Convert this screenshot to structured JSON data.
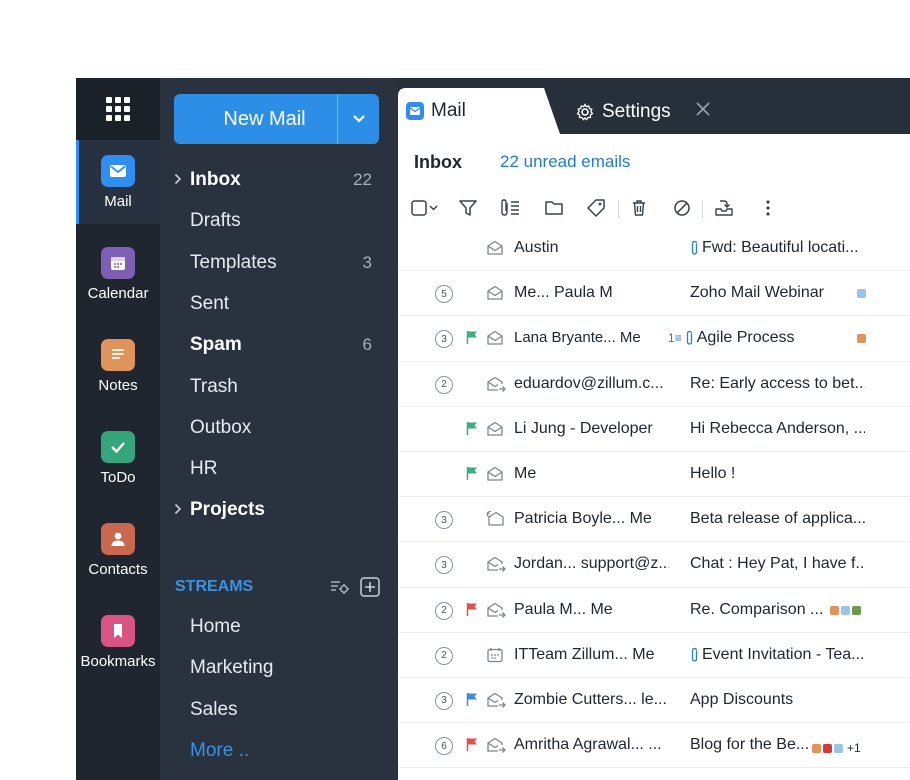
{
  "rail": {
    "items": [
      {
        "label": "Mail",
        "icon": "mail-icon",
        "color": "#2f8ef0",
        "active": true
      },
      {
        "label": "Calendar",
        "icon": "calendar-icon",
        "color": "#7e5fb5"
      },
      {
        "label": "Notes",
        "icon": "notes-icon",
        "color": "#e0935a"
      },
      {
        "label": "ToDo",
        "icon": "todo-icon",
        "color": "#35a57c"
      },
      {
        "label": "Contacts",
        "icon": "contacts-icon",
        "color": "#c8684f"
      },
      {
        "label": "Bookmarks",
        "icon": "bookmarks-icon",
        "color": "#d95482"
      }
    ]
  },
  "folders": {
    "new_mail_label": "New Mail",
    "items": [
      {
        "label": "Inbox",
        "count": "22",
        "bold": true,
        "expandable": true
      },
      {
        "label": "Drafts",
        "count": ""
      },
      {
        "label": "Templates",
        "count": "3"
      },
      {
        "label": "Sent",
        "count": ""
      },
      {
        "label": "Spam",
        "count": "6",
        "bold": true
      },
      {
        "label": "Trash",
        "count": ""
      },
      {
        "label": "Outbox",
        "count": ""
      },
      {
        "label": "HR",
        "count": ""
      },
      {
        "label": "Projects",
        "count": "",
        "bold": true,
        "expandable": true
      }
    ],
    "streams_title": "STREAMS",
    "streams": [
      "Home",
      "Marketing",
      "Sales"
    ],
    "more_label": "More .."
  },
  "tabs": {
    "mail_label": "Mail",
    "settings_label": "Settings"
  },
  "header": {
    "title": "Inbox",
    "unread": "22 unread emails"
  },
  "emails": [
    {
      "count": "",
      "flag": "",
      "icon": "envelope-open-icon",
      "sender": "Austin",
      "subject": "Fwd: Beautiful locati...",
      "attach": true,
      "thread": "",
      "tags": [],
      "bold": false
    },
    {
      "count": "5",
      "flag": "",
      "icon": "envelope-open-icon",
      "sender": "Me... Paula M",
      "subject": "Zoho Mail Webinar",
      "attach": false,
      "thread": "",
      "tags": [
        "#9cc3ea"
      ],
      "bold": false
    },
    {
      "count": "3",
      "flag": "#3fae7e",
      "icon": "envelope-open-icon",
      "sender": "Lana Bryante... Me",
      "subject": "Agile Process",
      "attach": true,
      "thread": "1",
      "tags": [
        "#e0935a"
      ],
      "bold": true
    },
    {
      "count": "2",
      "flag": "",
      "icon": "envelope-forward-icon",
      "sender": "eduardov@zillum.c...",
      "subject": "Re: Early access to bet...",
      "attach": false,
      "thread": "",
      "tags": [],
      "bold": false
    },
    {
      "count": "",
      "flag": "#3fae7e",
      "icon": "envelope-open-icon",
      "sender": "Li Jung - Developer",
      "subject": "Hi Rebecca Anderson, ...",
      "attach": false,
      "thread": "",
      "tags": [],
      "bold": false
    },
    {
      "count": "",
      "flag": "#3fae7e",
      "icon": "envelope-open-icon",
      "sender": "Me",
      "subject": "Hello !",
      "attach": false,
      "thread": "",
      "tags": [],
      "bold": false
    },
    {
      "count": "3",
      "flag": "",
      "icon": "envelope-reply-icon",
      "sender": "Patricia Boyle... Me",
      "subject": "Beta release of applica...",
      "attach": false,
      "thread": "",
      "tags": [],
      "bold": false
    },
    {
      "count": "3",
      "flag": "",
      "icon": "envelope-forward-icon",
      "sender": "Jordan... support@z...",
      "subject": "Chat : Hey Pat, I have f...",
      "attach": false,
      "thread": "",
      "tags": [],
      "bold": false
    },
    {
      "count": "2",
      "flag": "#e05050",
      "icon": "envelope-forward-icon",
      "sender": "Paula M... Me",
      "subject": "Re. Comparison ...",
      "attach": false,
      "thread": "",
      "tags": [
        "#e0935a",
        "#9cc3ea",
        "#6a9a4a"
      ],
      "bold": false
    },
    {
      "count": "2",
      "flag": "",
      "icon": "calendar-event-icon",
      "sender": "ITTeam Zillum... Me",
      "subject": "Event Invitation - Tea...",
      "attach": true,
      "thread": "",
      "tags": [],
      "bold": false
    },
    {
      "count": "3",
      "flag": "#3a8de0",
      "icon": "envelope-forward-icon",
      "sender": "Zombie Cutters... le...",
      "subject": "App Discounts",
      "attach": false,
      "thread": "",
      "tags": [],
      "bold": false
    },
    {
      "count": "6",
      "flag": "#e05050",
      "icon": "envelope-forward-icon",
      "sender": "Amritha Agrawal... ...",
      "subject": "Blog for the Be...",
      "attach": false,
      "thread": "",
      "tags": [
        "#e0935a",
        "#d03c3c",
        "#9cc3ea"
      ],
      "more_tags": "+1",
      "bold": false
    }
  ]
}
